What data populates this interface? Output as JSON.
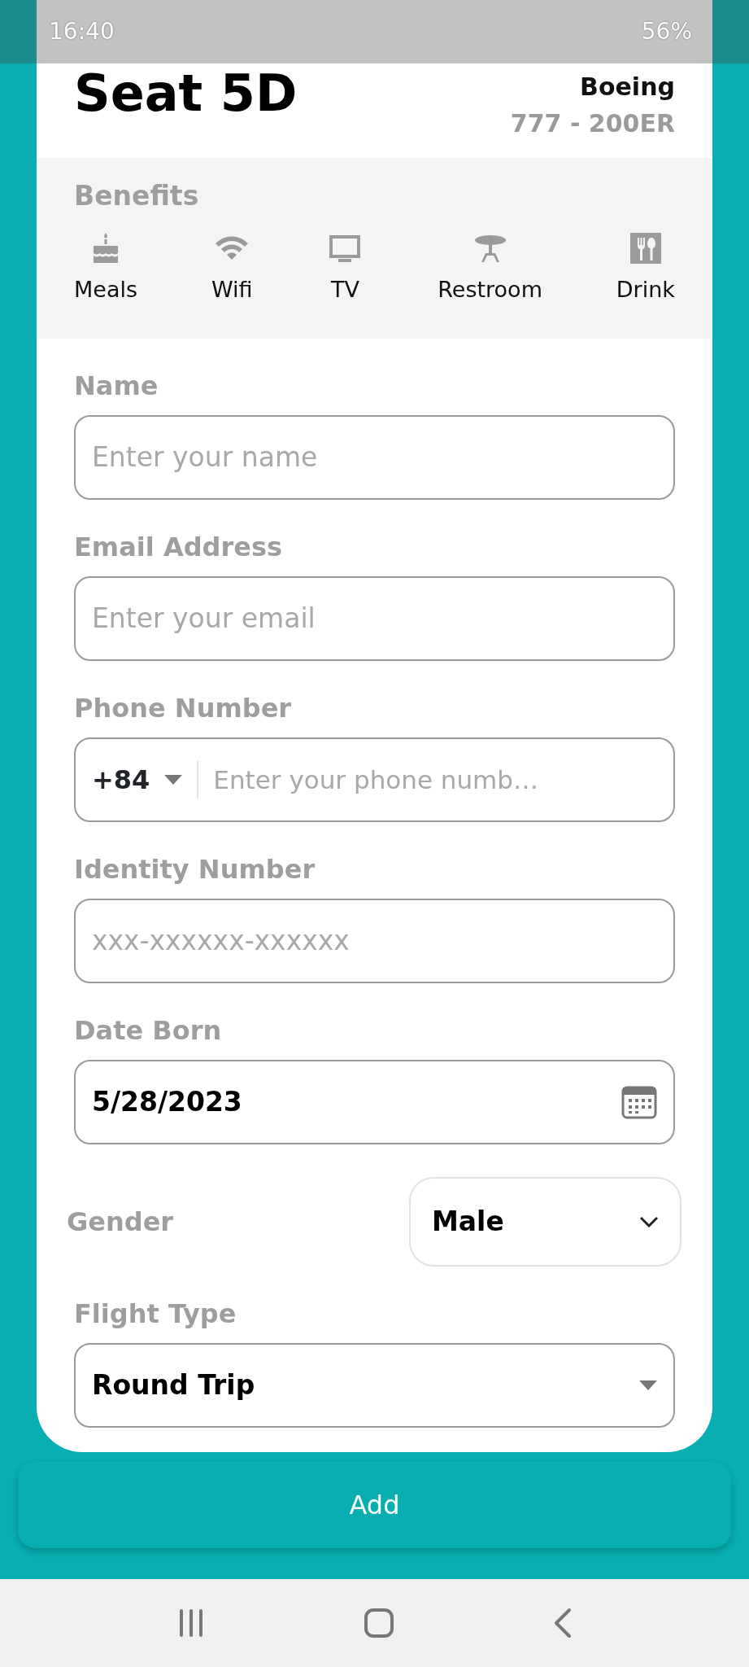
{
  "status_bar": {
    "time": "16:40",
    "battery": "56%"
  },
  "seat": {
    "title": "Seat 5D",
    "aircraft_maker": "Boeing",
    "aircraft_model": "777 - 200ER"
  },
  "benefits": {
    "title": "Benefits",
    "items": [
      {
        "label": "Meals",
        "kind": "cake"
      },
      {
        "label": "Wifi",
        "kind": "wifi"
      },
      {
        "label": "TV",
        "kind": "tv"
      },
      {
        "label": "Restroom",
        "kind": "table"
      },
      {
        "label": "Drink",
        "kind": "cutlery"
      }
    ]
  },
  "form": {
    "fields": [
      {
        "kind": "text",
        "label": "Name",
        "placeholder": "Enter your name"
      },
      {
        "kind": "text",
        "label": "Email Address",
        "placeholder": "Enter your email"
      },
      {
        "kind": "phone",
        "label": "Phone Number",
        "country_code": "+84",
        "placeholder": "Enter your phone numb…"
      },
      {
        "kind": "text",
        "label": "Identity Number",
        "placeholder": "xxx-xxxxxx-xxxxxx"
      },
      {
        "kind": "date",
        "label": "Date Born",
        "value": "5/28/2023"
      },
      {
        "kind": "inline_select",
        "label": "Gender",
        "value": "Male"
      },
      {
        "kind": "select",
        "label": "Flight Type",
        "value": "Round Trip"
      }
    ]
  },
  "add_button": "Add"
}
